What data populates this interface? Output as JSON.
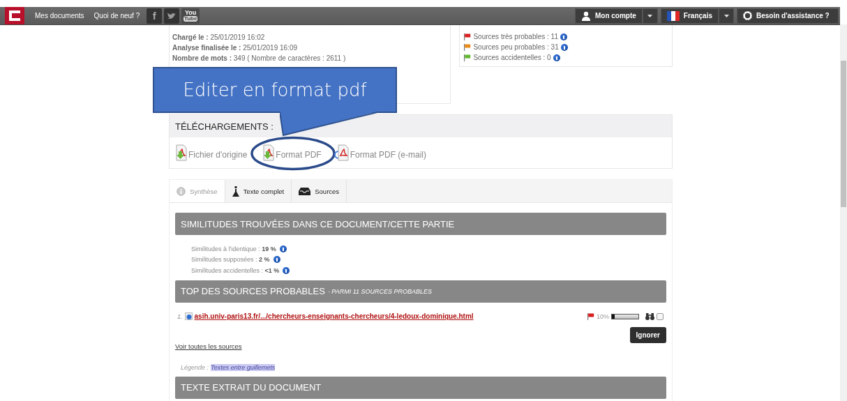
{
  "navbar": {
    "links": [
      "Mes documents",
      "Quoi de neuf ?"
    ],
    "social": [
      {
        "kind": "facebook",
        "text": "f"
      },
      {
        "kind": "twitter"
      },
      {
        "kind": "youtube",
        "text": "You",
        "badge": "Tube"
      }
    ],
    "menus": [
      {
        "kind": "account",
        "label": "Mon compte",
        "dropdown": true
      },
      {
        "kind": "language",
        "label": "Français",
        "dropdown": true
      },
      {
        "kind": "help",
        "label": "Besoin d'assistance ?",
        "dropdown": false
      }
    ]
  },
  "document_info": [
    {
      "label": "Chargé le :",
      "value": "25/01/2019 16:02"
    },
    {
      "label": "Analyse finalisée le :",
      "value": "25/01/2019 16:09"
    },
    {
      "label": "Nombre de mots :",
      "value": "349 ( Nombre de caractères : 2611 )"
    }
  ],
  "source_summary": [
    {
      "label": "Sources très probables : 11",
      "color": "#d81e1e"
    },
    {
      "label": "Sources peu probables : 31",
      "color": "#e88a1a"
    },
    {
      "label": "Sources accidentelles : 0",
      "color": "#5fb830"
    }
  ],
  "callout": {
    "text": "Editer en format pdf"
  },
  "downloads": {
    "title": "TÉLÉCHARGEMENTS :",
    "items": [
      {
        "kind": "file",
        "label": "Fichier d'origine",
        "circled": false
      },
      {
        "kind": "pdf",
        "label": "Format PDF",
        "circled": true
      },
      {
        "kind": "email",
        "label": "Format PDF (e-mail)",
        "circled": false
      }
    ]
  },
  "tabs": [
    {
      "kind": "info",
      "label": "Synthèse",
      "selected": true
    },
    {
      "kind": "flask",
      "label": "Texte complet",
      "selected": false
    },
    {
      "kind": "inbox",
      "label": "Sources",
      "selected": false
    }
  ],
  "similarities": {
    "title": "SIMILITUDES TROUVÉES DANS CE DOCUMENT/CETTE PARTIE",
    "stats": [
      "Similitudes à l'identique : **19 %**",
      "Similitudes supposées : **2 %**",
      "Similitudes accidentelles : **<1 %**"
    ]
  },
  "top_sources": {
    "title": "TOP DES SOURCES PROBABLES",
    "subtitle": "- PARMI 11 SOURCES PROBABLES",
    "sources": [
      {
        "index": "1.",
        "url": "asih.univ-paris13.fr/.../chercheurs-enseignants-chercheurs/4-ledoux-dominique.html",
        "color": "#d81e1e",
        "percent": "10%",
        "level": 0.1,
        "checked": false
      }
    ],
    "ignore_button": "Ignorer",
    "see_all_link": "Voir toutes les sources",
    "legend": {
      "label": "Légende :",
      "sample": "Textes entre guillemets"
    }
  },
  "extract": {
    "title": "TEXTE EXTRAIT DU DOCUMENT"
  }
}
